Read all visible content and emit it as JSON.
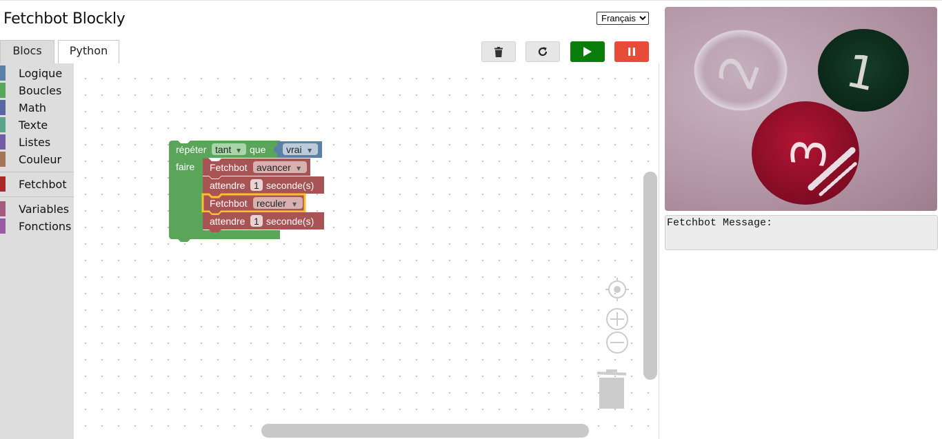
{
  "app": {
    "title": "Fetchbot Blockly"
  },
  "language": {
    "selected": "Français"
  },
  "tabs": [
    {
      "label": "Blocs",
      "active": true
    },
    {
      "label": "Python",
      "active": false
    }
  ],
  "toolbar": {
    "trash_icon": "trash-icon",
    "reload_icon": "reload-icon",
    "run_icon": "play-icon",
    "stop_icon": "pause-icon"
  },
  "toolbox": {
    "categories": [
      {
        "label": "Logique",
        "color": "#5b80a5"
      },
      {
        "label": "Boucles",
        "color": "#5ba55b"
      },
      {
        "label": "Math",
        "color": "#5b67a5"
      },
      {
        "label": "Texte",
        "color": "#5ba58c"
      },
      {
        "label": "Listes",
        "color": "#745ba5"
      },
      {
        "label": "Couleur",
        "color": "#a5745b"
      },
      {
        "label": "Fetchbot",
        "color": "#a52a2a"
      },
      {
        "label": "Variables",
        "color": "#a55b80"
      },
      {
        "label": "Fonctions",
        "color": "#995ba5"
      }
    ]
  },
  "blocks": {
    "loop": {
      "repeat_label": "répéter",
      "mode": "tant",
      "que_label": "que",
      "condition": "vrai",
      "do_label": "faire",
      "color": "#5ba55b"
    },
    "statements": [
      {
        "prefix": "Fetchbot",
        "action": "avancer"
      },
      {
        "prefix": "attendre",
        "value": "1",
        "suffix": "seconde(s)"
      },
      {
        "prefix": "Fetchbot",
        "action": "reculer",
        "selected": true
      },
      {
        "prefix": "attendre",
        "value": "1",
        "suffix": "seconde(s)"
      }
    ],
    "fetchbot_color": "#a85454",
    "logic_color": "#5b80a5",
    "highlight_color": "#fbc02d"
  },
  "camera": {
    "tokens": [
      "2",
      "1",
      "3"
    ]
  },
  "message": {
    "label": "Fetchbot Message:"
  }
}
